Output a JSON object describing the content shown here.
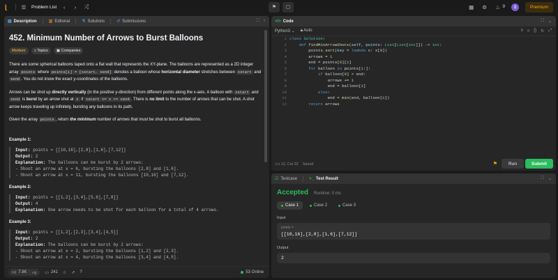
{
  "topbar": {
    "title": "Problem List",
    "streak": "0",
    "avatar_letter": "g",
    "premium": "Premium"
  },
  "left": {
    "tabs": [
      {
        "label": "Description"
      },
      {
        "label": "Editorial"
      },
      {
        "label": "Solutions"
      },
      {
        "label": "Submissions"
      }
    ],
    "title": "452. Minimum Number of Arrows to Burst Balloons",
    "chips": {
      "difficulty": "Medium",
      "topics": "Topics",
      "companies": "Companies"
    },
    "para1_a": "There are some spherical balloons taped onto a flat wall that represents the XY-plane. The balloons are represented as a 2D integer array ",
    "para1_points": "points",
    "para1_b": " where ",
    "para1_pi": "points[i] = [x",
    "para1_c": " denotes a balloon whose ",
    "para1_bold": "horizontal diameter",
    "para1_d": " stretches between ",
    "para1_e": " and ",
    "para1_f": ". You do not know the exact y-coordinates of the balloons.",
    "para1_pi_rest": "start, xend]",
    "xstart": "xstart",
    "xend": "xend",
    "para2_a": "Arrows can be shot up ",
    "para2_bold1": "directly vertically",
    "para2_b": " (in the positive y-direction) from different points along the x-axis. A balloon with ",
    "para2_c": " and ",
    "para2_d": " is ",
    "para2_bold2": "burst",
    "para2_e": " by an arrow shot at ",
    "para2_x": "x",
    "para2_f": " if ",
    "para2_cond": "xstart <= x <= xend",
    "para2_g": ". There is ",
    "para2_bold3": "no limit",
    "para2_h": " to the number of arrows that can be shot. A shot arrow keeps traveling up infinitely, bursting any balloons in its path.",
    "para3_a": "Given the array ",
    "para3_points": "points",
    "para3_b": ", return ",
    "para3_em": "the minimum",
    "para3_c": " number of arrows that must be shot to burst all balloons.",
    "examples": [
      {
        "heading": "Example 1:",
        "input_label": "Input:",
        "input": " points = [[10,16],[2,8],[1,6],[7,12]]",
        "output_label": "Output:",
        "output": " 2",
        "expl_label": "Explanation:",
        "expl": " The balloons can be burst by 2 arrows:",
        "lines": [
          "- Shoot an arrow at x = 6, bursting the balloons [2,8] and [1,6].",
          "- Shoot an arrow at x = 11, bursting the balloons [10,16] and [7,12]."
        ]
      },
      {
        "heading": "Example 2:",
        "input_label": "Input:",
        "input": " points = [[1,2],[3,4],[5,6],[7,8]]",
        "output_label": "Output:",
        "output": " 4",
        "expl_label": "Explanation:",
        "expl": " One arrow needs to be shot for each balloon for a total of 4 arrows.",
        "lines": []
      },
      {
        "heading": "Example 3:",
        "input_label": "Input:",
        "input": " points = [[1,2],[2,3],[3,4],[4,5]]",
        "output_label": "Output:",
        "output": " 2",
        "expl_label": "Explanation:",
        "expl": " The balloons can be burst by 2 arrows:",
        "lines": [
          "- Shoot an arrow at x = 2, bursting the balloons [1,2] and [2,3].",
          "- Shoot an arrow at x = 4, bursting the balloons [3,4] and [4,5]."
        ]
      }
    ],
    "bottom": {
      "likes": "7.8K",
      "comments": "241",
      "online": "53 Online"
    }
  },
  "code": {
    "tab": "Code",
    "language": "Python3",
    "auto": "Auto",
    "lines": [
      "class Solution:",
      "    def findMinArrowShots(self, points: List[List[int]]) -> int:",
      "        points.sort(key = lambda x: x[0])",
      "        arrows = 1",
      "        end = points[0][1]",
      "        for balloon in points[1:]:",
      "            if balloon[0] > end:",
      "                arrows += 1",
      "                end = balloon[1]",
      "            else:",
      "                end = min(end, balloon[1])",
      "        return arrows"
    ],
    "status_pos": "Ln 12, Col 22",
    "status_saved": "Saved",
    "run": "Run",
    "submit": "Submit"
  },
  "result": {
    "tabs": [
      {
        "label": "Testcase"
      },
      {
        "label": "Test Result"
      }
    ],
    "accepted": "Accepted",
    "runtime": "Runtime: 0 ms",
    "cases": [
      "Case 1",
      "Case 2",
      "Case 3"
    ],
    "input_label": "Input",
    "param_name": "points =",
    "param_value": "[[10,16],[2,8],[1,6],[7,12]]",
    "output_label": "Output",
    "output_value": "2"
  },
  "colors": {
    "accent": "#ffa116",
    "success": "#2cbb5d",
    "medium": "#ffc01e"
  },
  "icons": [
    "leetcode-logo-icon",
    "list-icon",
    "chevron-left-icon",
    "chevron-right-icon",
    "shuffle-icon",
    "debug-icon",
    "notes-icon",
    "panel-icon",
    "gear-icon",
    "fire-icon",
    "lock-icon",
    "bookmark-icon",
    "reset-icon",
    "expand-icon",
    "thumbs-up-icon",
    "comment-icon",
    "star-icon",
    "share-icon",
    "question-icon"
  ]
}
